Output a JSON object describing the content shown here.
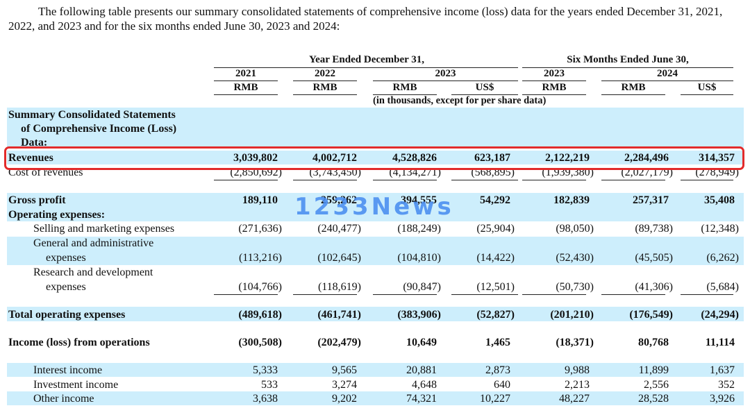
{
  "intro": "The following table presents our summary consolidated statements of comprehensive income (loss) data for the years ended December 31, 2021, 2022, and 2023 and for the six months ended June 30, 2023 and 2024:",
  "header": {
    "group1": "Year Ended December 31,",
    "group2": "Six Months Ended June 30,",
    "years": [
      "2021",
      "2022",
      "2023",
      "2023",
      "2024"
    ],
    "currencies": [
      "RMB",
      "RMB",
      "RMB",
      "US$",
      "RMB",
      "RMB",
      "US$"
    ],
    "note": "(in thousands, except for per share data)"
  },
  "section_title": [
    "Summary Consolidated Statements",
    "of Comprehensive Income (Loss)",
    "Data:"
  ],
  "rows": [
    {
      "label": "Revenues",
      "values": [
        "3,039,802",
        "4,002,712",
        "4,528,826",
        "623,187",
        "2,122,219",
        "2,284,496",
        "314,357"
      ]
    },
    {
      "label": "Cost of revenues",
      "values": [
        "(2,850,692)",
        "(3,743,450)",
        "(4,134,271)",
        "(568,895)",
        "(1,939,380)",
        "(2,027,179)",
        "(278,949)"
      ]
    },
    {
      "label": "Gross profit",
      "values": [
        "189,110",
        "259,262",
        "394,555",
        "54,292",
        "182,839",
        "257,317",
        "35,408"
      ]
    },
    {
      "label": "Operating expenses:",
      "values": []
    },
    {
      "label": "Selling and marketing expenses",
      "values": [
        "(271,636)",
        "(240,477)",
        "(188,249)",
        "(25,904)",
        "(98,050)",
        "(89,738)",
        "(12,348)"
      ]
    },
    {
      "label": [
        "General and administrative",
        "expenses"
      ],
      "values": [
        "(113,216)",
        "(102,645)",
        "(104,810)",
        "(14,422)",
        "(52,430)",
        "(45,505)",
        "(6,262)"
      ]
    },
    {
      "label": [
        "Research and development",
        "expenses"
      ],
      "values": [
        "(104,766)",
        "(118,619)",
        "(90,847)",
        "(12,501)",
        "(50,730)",
        "(41,306)",
        "(5,684)"
      ]
    },
    {
      "label": "Total operating expenses",
      "values": [
        "(489,618)",
        "(461,741)",
        "(383,906)",
        "(52,827)",
        "(201,210)",
        "(176,549)",
        "(24,294)"
      ]
    },
    {
      "label": "Income (loss) from operations",
      "values": [
        "(300,508)",
        "(202,479)",
        "10,649",
        "1,465",
        "(18,371)",
        "80,768",
        "11,114"
      ]
    },
    {
      "label": "Interest income",
      "values": [
        "5,333",
        "9,565",
        "20,881",
        "2,873",
        "9,988",
        "11,899",
        "1,637"
      ]
    },
    {
      "label": "Investment income",
      "values": [
        "533",
        "3,274",
        "4,648",
        "640",
        "2,213",
        "2,556",
        "352"
      ]
    },
    {
      "label": "Other income",
      "values": [
        "3,638",
        "9,202",
        "74,321",
        "10,227",
        "48,227",
        "28,528",
        "3,926"
      ]
    }
  ],
  "watermark": "1233News",
  "colors": {
    "shade": "#cdeefc",
    "highlight": "#e22b2b",
    "watermark": "#4a8ef0"
  }
}
